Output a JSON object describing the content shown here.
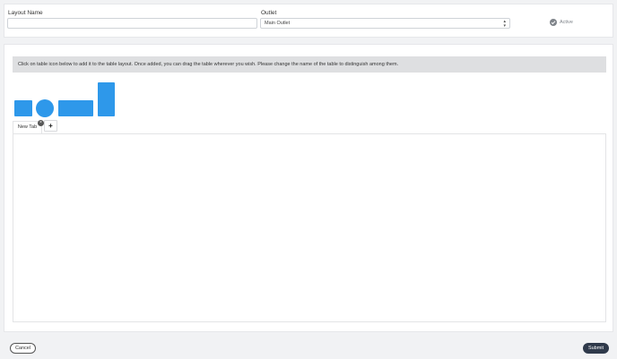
{
  "form": {
    "layout_name_label": "Layout Name",
    "layout_name_value": "",
    "layout_name_placeholder": "",
    "outlet_label": "Outlet",
    "outlet_selected": "Main Outlet",
    "active_label": "Active"
  },
  "designer": {
    "info_text": "Click on table icon below to add it to the table layout. Once added, you can drag the table wherever you wish. Please change the name of the table to distinguish among them.",
    "table_shapes": [
      {
        "name": "square-table-icon"
      },
      {
        "name": "round-table-icon"
      },
      {
        "name": "long-rectangle-table-icon"
      },
      {
        "name": "tall-rectangle-table-icon"
      }
    ],
    "tabs": [
      {
        "label": "New Tab"
      }
    ],
    "add_tab_label": "+",
    "close_tab_label": "×"
  },
  "footer": {
    "cancel_label": "Cancel",
    "submit_label": "Submit"
  },
  "colors": {
    "accent": "#2e98ea",
    "submit_bg": "#2f3a4b",
    "info_bg": "#dedfe1"
  },
  "icons": {
    "active": "check-circle-icon",
    "select": "up-down-arrows-icon"
  }
}
